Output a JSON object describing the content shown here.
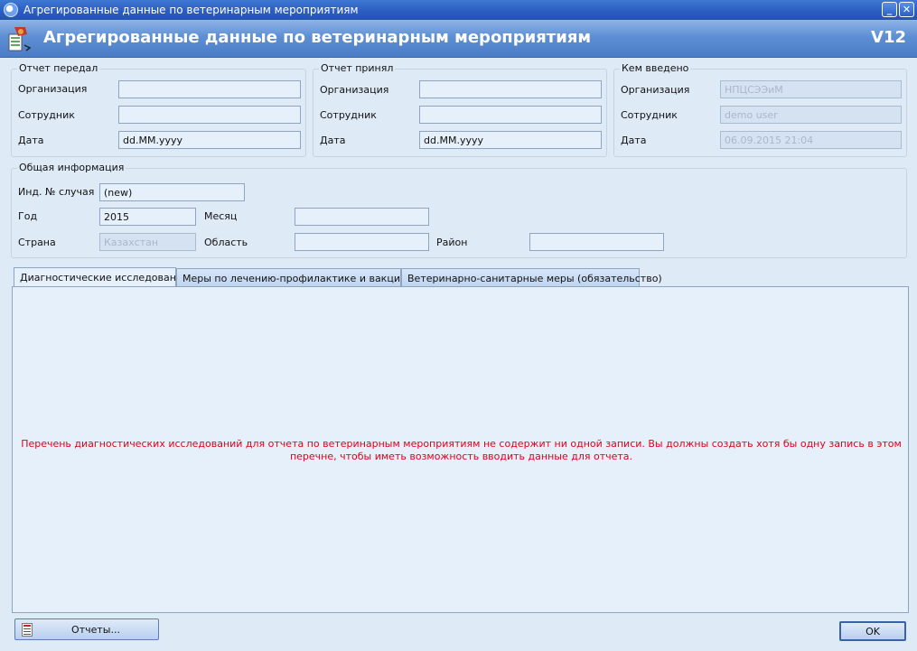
{
  "window": {
    "title": "Агрегированные данные по ветеринарным мероприятиям",
    "minimize_glyph": "_",
    "close_glyph": "✕"
  },
  "header": {
    "title": "Агрегированные данные по ветеринарным мероприятиям",
    "version": "V12",
    "logo_icon": "report-form-icon"
  },
  "sent_by": {
    "legend": "Отчет передал",
    "organization_label": "Организация",
    "organization_value": "",
    "employee_label": "Сотрудник",
    "employee_value": "",
    "date_label": "Дата",
    "date_value": "dd.MM.yyyy"
  },
  "received_by": {
    "legend": "Отчет принял",
    "organization_label": "Организация",
    "organization_value": "",
    "employee_label": "Сотрудник",
    "employee_value": "",
    "date_label": "Дата",
    "date_value": "dd.MM.yyyy"
  },
  "entered_by": {
    "legend": "Кем введено",
    "organization_label": "Организация",
    "organization_value": "НПЦСЭЭиМ",
    "employee_label": "Сотрудник",
    "employee_value": "demo user",
    "date_label": "Дата",
    "date_value": "06.09.2015 21:04"
  },
  "general": {
    "legend": "Общая информация",
    "case_id_label": "Инд. № случая",
    "case_id_value": "(new)",
    "year_label": "Год",
    "year_value": "2015",
    "month_label": "Месяц",
    "month_value": "",
    "country_label": "Страна",
    "country_value": "Казахстан",
    "region_label": "Область",
    "region_value": "",
    "district_label": "Район",
    "district_value": ""
  },
  "tabs": [
    {
      "label": "Диагностические исследования",
      "active": true
    },
    {
      "label": "Меры по лечению-профилактике и вакцинации",
      "active": false
    },
    {
      "label": "Ветеринарно-санитарные меры (обязательство)",
      "active": false
    }
  ],
  "panel": {
    "message": "Перечень диагностических исследований для отчета по ветеринарным мероприятиям не содержит ни одной записи. Вы должны создать хотя бы одну запись в этом перечне, чтобы иметь возможность вводить данные для отчета.",
    "message_color": "#e0001b"
  },
  "footer": {
    "reports_label": "Отчеты...",
    "reports_icon": "report-document-icon",
    "ok_label": "OK"
  }
}
